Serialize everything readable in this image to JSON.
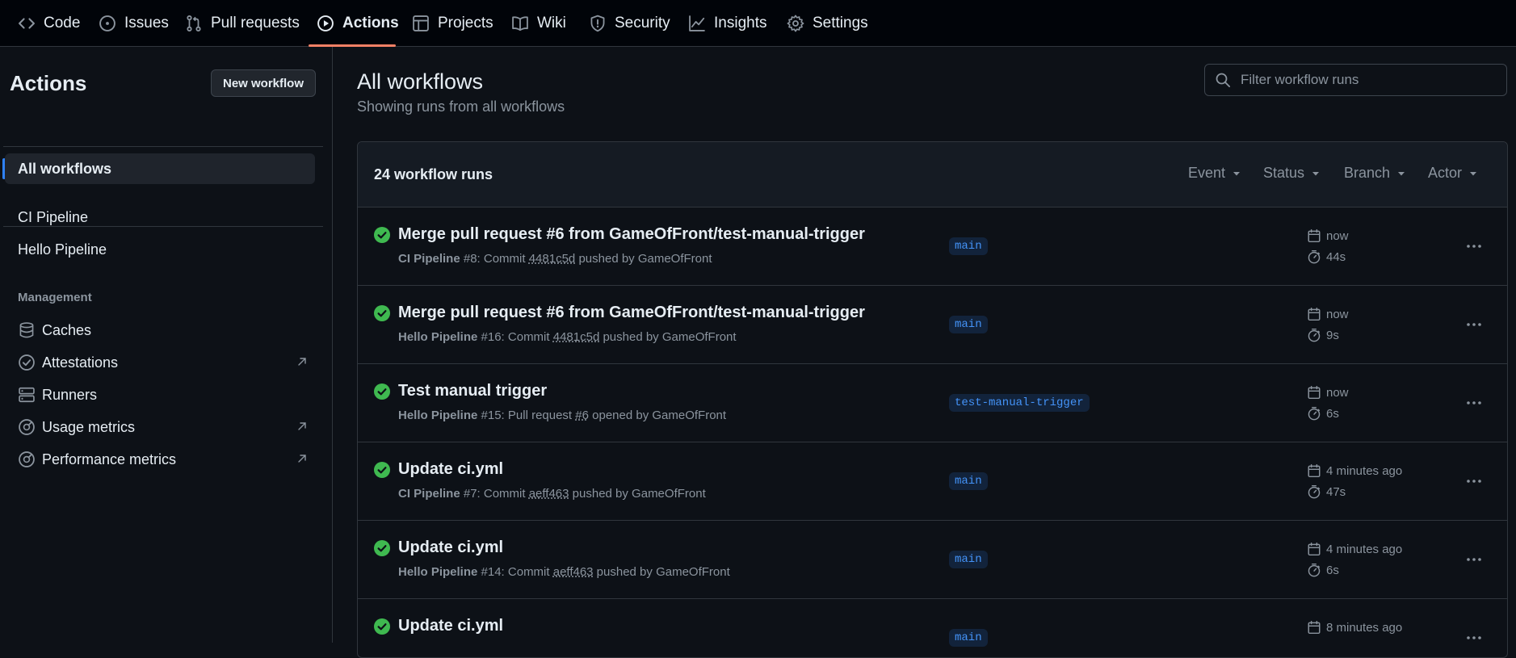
{
  "nav": {
    "tabs": [
      {
        "label": "Code",
        "icon": "code-icon"
      },
      {
        "label": "Issues",
        "icon": "issue-opened-icon"
      },
      {
        "label": "Pull requests",
        "icon": "git-pull-request-icon"
      },
      {
        "label": "Actions",
        "icon": "play-icon",
        "active": true
      },
      {
        "label": "Projects",
        "icon": "table-icon"
      },
      {
        "label": "Wiki",
        "icon": "book-icon"
      },
      {
        "label": "Security",
        "icon": "shield-icon"
      },
      {
        "label": "Insights",
        "icon": "graph-icon"
      },
      {
        "label": "Settings",
        "icon": "gear-icon"
      }
    ]
  },
  "sidebar": {
    "title": "Actions",
    "new_workflow": "New workflow",
    "all_workflows": "All workflows",
    "workflows": [
      "CI Pipeline",
      "Hello Pipeline"
    ],
    "management_heading": "Management",
    "management": [
      {
        "label": "Caches",
        "icon": "database-icon",
        "external": false
      },
      {
        "label": "Attestations",
        "icon": "verified-icon",
        "external": true
      },
      {
        "label": "Runners",
        "icon": "server-icon",
        "external": false
      },
      {
        "label": "Usage metrics",
        "icon": "meter-icon",
        "external": true
      },
      {
        "label": "Performance metrics",
        "icon": "meter-icon",
        "external": true
      }
    ]
  },
  "main": {
    "title": "All workflows",
    "subtitle": "Showing runs from all workflows",
    "filter_placeholder": "Filter workflow runs",
    "runs_count": "24 workflow runs",
    "filters": [
      "Event",
      "Status",
      "Branch",
      "Actor"
    ],
    "runs": [
      {
        "title": "Merge pull request #6 from GameOfFront/test-manual-trigger",
        "workflow": "CI Pipeline",
        "meta_pre": " #8: Commit ",
        "link": "4481c5d",
        "meta_post": " pushed by GameOfFront",
        "branch": "main",
        "when": "now",
        "duration": "44s"
      },
      {
        "title": "Merge pull request #6 from GameOfFront/test-manual-trigger",
        "workflow": "Hello Pipeline",
        "meta_pre": " #16: Commit ",
        "link": "4481c5d",
        "meta_post": " pushed by GameOfFront",
        "branch": "main",
        "when": "now",
        "duration": "9s"
      },
      {
        "title": "Test manual trigger",
        "workflow": "Hello Pipeline",
        "meta_pre": " #15: Pull request ",
        "link": "#6",
        "meta_post": " opened by GameOfFront",
        "branch": "test-manual-trigger",
        "when": "now",
        "duration": "6s"
      },
      {
        "title": "Update ci.yml",
        "workflow": "CI Pipeline",
        "meta_pre": " #7: Commit ",
        "link": "aeff463",
        "meta_post": " pushed by GameOfFront",
        "branch": "main",
        "when": "4 minutes ago",
        "duration": "47s"
      },
      {
        "title": "Update ci.yml",
        "workflow": "Hello Pipeline",
        "meta_pre": " #14: Commit ",
        "link": "aeff463",
        "meta_post": " pushed by GameOfFront",
        "branch": "main",
        "when": "4 minutes ago",
        "duration": "6s"
      },
      {
        "title": "Update ci.yml",
        "workflow": "",
        "meta_pre": "",
        "link": "",
        "meta_post": "",
        "branch": "main",
        "when": "8 minutes ago",
        "duration": ""
      }
    ]
  },
  "colors": {
    "background": "#0d1117",
    "accent_underline": "#f78166",
    "selected_marker": "#2f81f7",
    "success": "#3fb950",
    "branch_text": "#4493f8"
  }
}
